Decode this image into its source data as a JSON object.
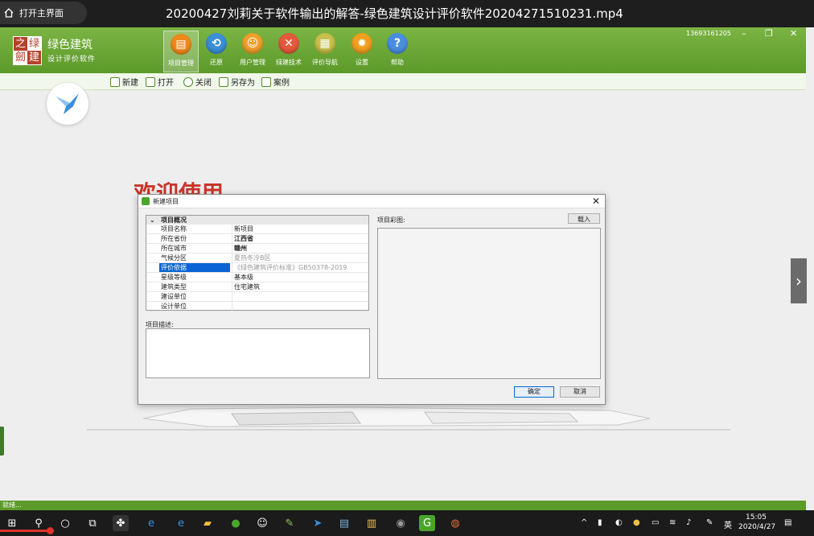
{
  "player": {
    "home_label": "打开主界面",
    "video_title": "20200427刘莉关于软件输出的解答-绿色建筑设计评价软件20204271510231.mp4"
  },
  "app": {
    "logo_chars": [
      "之",
      "绿",
      "劒",
      "建"
    ],
    "logo_title": "绿色建筑",
    "logo_subtitle": "设计评价软件",
    "toolbar": [
      {
        "label": "项目管理",
        "icon": "folder-icon",
        "color": "#f08a1c",
        "active": true
      },
      {
        "label": "还原",
        "icon": "restore-icon",
        "color": "#3a8fd6",
        "active": false
      },
      {
        "label": "用户管理",
        "icon": "user-icon",
        "color": "#f0a02a",
        "active": false
      },
      {
        "label": "绿建技术",
        "icon": "tech-icon",
        "color": "#e45a3c",
        "active": false
      },
      {
        "label": "评价导航",
        "icon": "nav-icon",
        "color": "#c8c04a",
        "active": false
      },
      {
        "label": "设置",
        "icon": "gear-icon",
        "color": "#f0a020",
        "active": false
      },
      {
        "label": "帮助",
        "icon": "help-icon",
        "color": "#4a8ee0",
        "active": false
      }
    ],
    "phone": "13693161205",
    "window_controls": {
      "minimize": "–",
      "restore": "❐",
      "close": "✕"
    }
  },
  "subtoolbar": [
    {
      "label": "新建",
      "icon": "new-file-icon"
    },
    {
      "label": "打开",
      "icon": "open-folder-icon"
    },
    {
      "label": "关闭",
      "icon": "close-circle-icon"
    },
    {
      "label": "另存为",
      "icon": "save-as-icon"
    },
    {
      "label": "案例",
      "icon": "case-icon"
    }
  ],
  "main": {
    "welcome": "欢迎使用"
  },
  "dialog": {
    "title": "新建项目",
    "category": "项目概况",
    "rows": [
      {
        "key": "项目名称",
        "value": "新项目",
        "style": ""
      },
      {
        "key": "所在省份",
        "value": "江西省",
        "style": "bold"
      },
      {
        "key": "所在城市",
        "value": "赣州",
        "style": "bold"
      },
      {
        "key": "气候分区",
        "value": "夏热冬冷B区",
        "style": "gray"
      },
      {
        "key": "评价依据",
        "value": "《绿色建筑评价标准》GB50378-2019",
        "style": "gray",
        "selected": true
      },
      {
        "key": "星级等级",
        "value": "基本级",
        "style": ""
      },
      {
        "key": "建筑类型",
        "value": "住宅建筑",
        "style": ""
      },
      {
        "key": "建设单位",
        "value": "",
        "style": ""
      },
      {
        "key": "设计单位",
        "value": "",
        "style": ""
      }
    ],
    "desc_label": "项目描述:",
    "image_label": "项目彩图:",
    "load_label": "载入",
    "ok_label": "确定",
    "cancel_label": "取消"
  },
  "status": {
    "text": "就绪..."
  },
  "taskbar": {
    "ime": "英",
    "time": "15:05",
    "date": "2020/4/27"
  }
}
